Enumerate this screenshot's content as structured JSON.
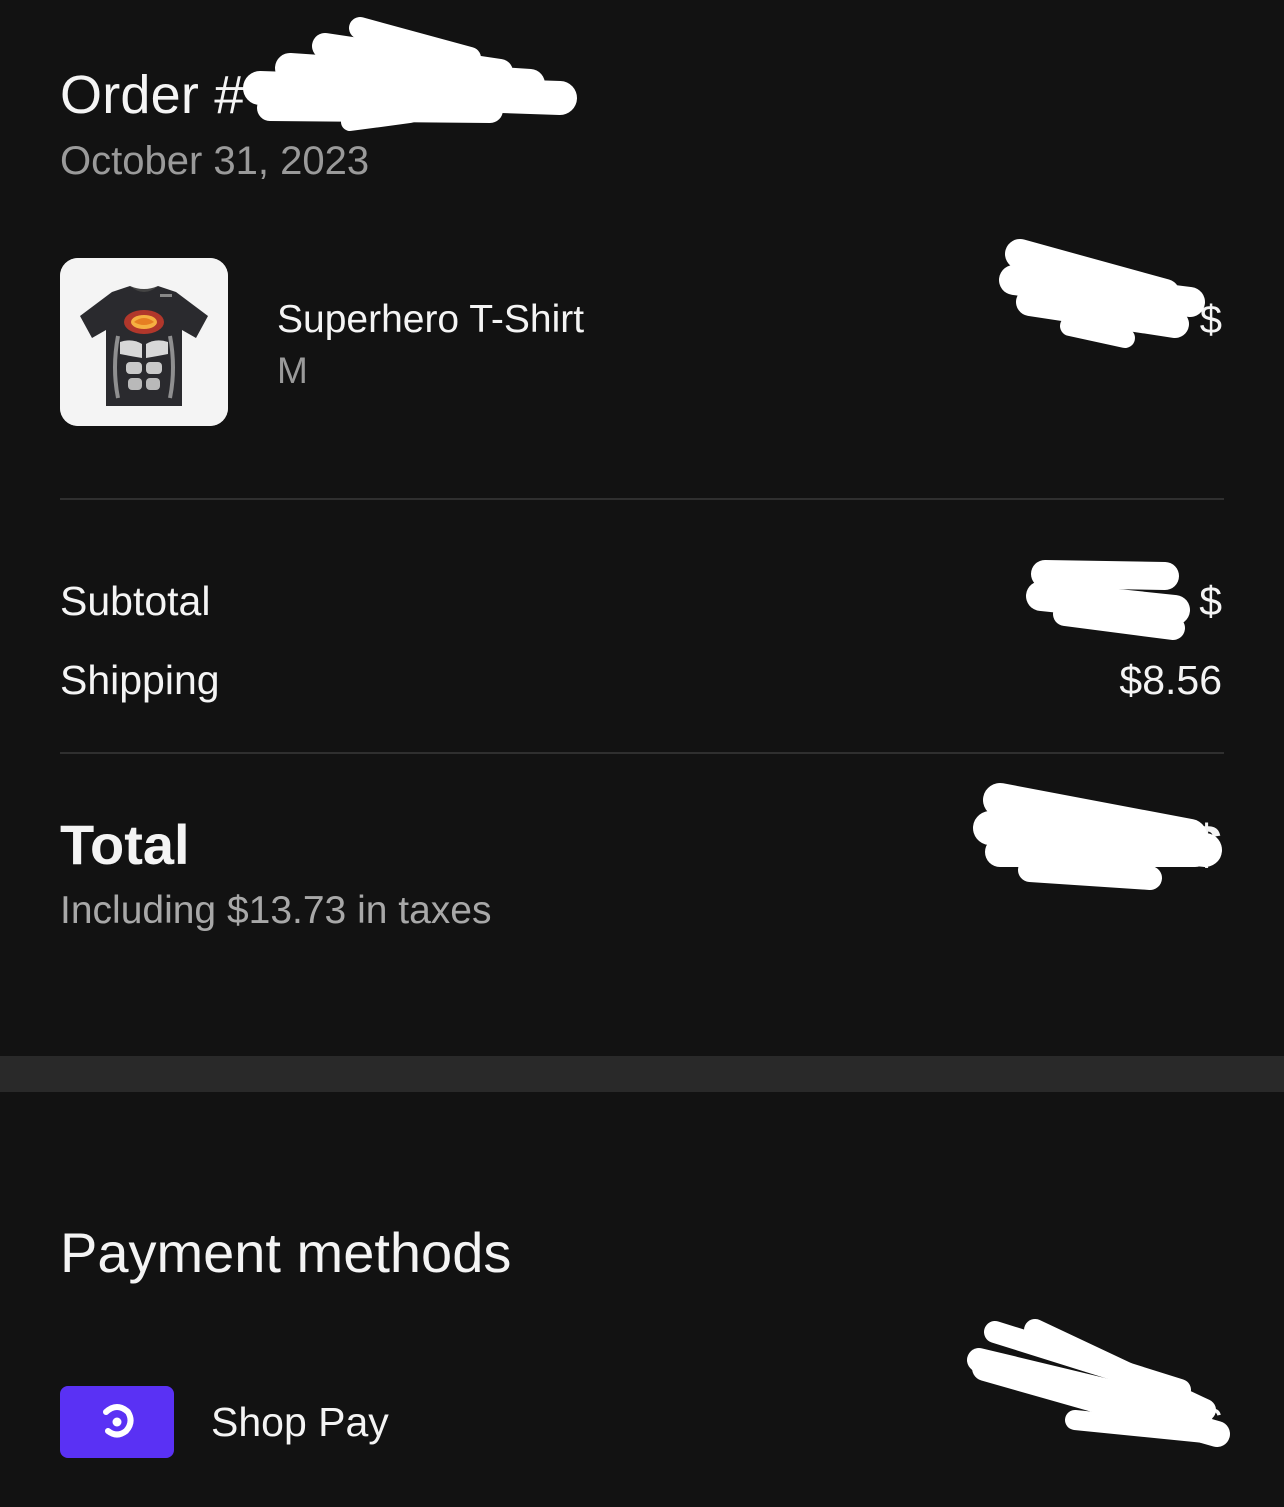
{
  "order": {
    "title": "Order #",
    "date": "October 31, 2023"
  },
  "item": {
    "name": "Superhero T-Shirt",
    "variant": "M",
    "price": "$",
    "thumbnail": "tshirt-image"
  },
  "summary": {
    "subtotal_label": "Subtotal",
    "subtotal_value": "$",
    "shipping_label": "Shipping",
    "shipping_value": "$8.56"
  },
  "total": {
    "label": "Total",
    "value": "$",
    "tax_note": "Including $13.73 in taxes"
  },
  "payment": {
    "heading": "Payment methods",
    "method_label": "Shop Pay",
    "method_icon": "shop-pay-icon",
    "amount": "$"
  },
  "colors": {
    "background": "#121212",
    "divider": "#2f2f2f",
    "section_gap": "#292929",
    "shop_pay_brand": "#5a31f4",
    "secondary_text": "#9a9a9a"
  }
}
